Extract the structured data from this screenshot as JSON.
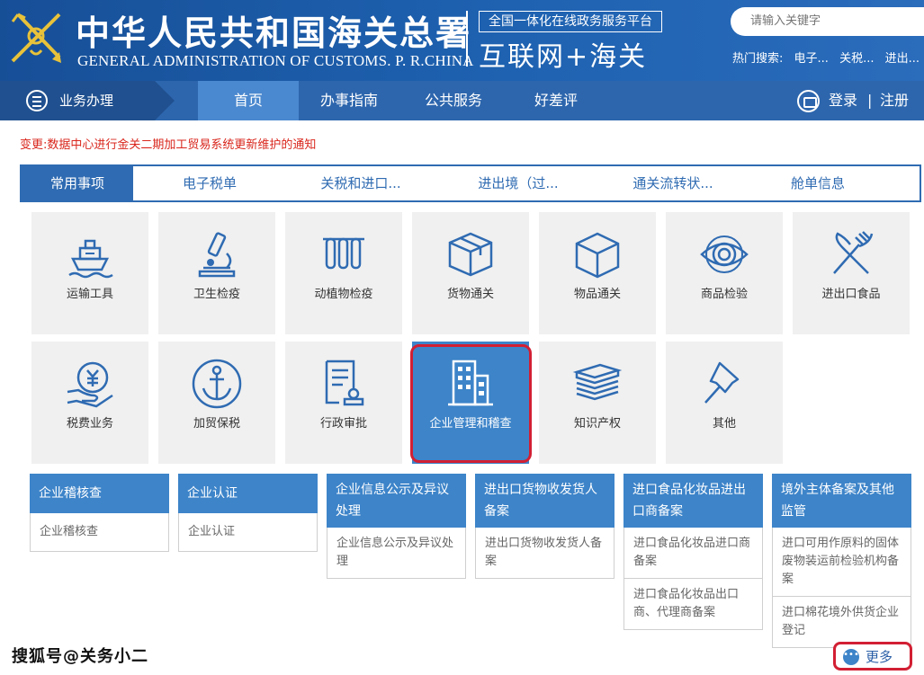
{
  "header": {
    "org_cn": "中华人民共和国海关总署",
    "org_en": "GENERAL ADMINISTRATION OF CUSTOMS. P. R.CHINA",
    "platform": "全国一体化在线政务服务平台",
    "platform_sub": "互联网+海关",
    "search_placeholder": "请输入关键字",
    "hot_label": "热门搜索:",
    "hot_items": [
      "电子...",
      "关税...",
      "进出..."
    ]
  },
  "nav": {
    "business": "业务办理",
    "items": [
      "首页",
      "办事指南",
      "公共服务",
      "好差评"
    ],
    "login": "登录",
    "separator": "|",
    "register": "注册"
  },
  "notice": "变更:数据中心进行金关二期加工贸易系统更新维护的通知",
  "tabs": [
    "常用事项",
    "电子税单",
    "关税和进口...",
    "进出境（过...",
    "通关流转状...",
    "舱单信息"
  ],
  "tiles": [
    {
      "label": "运输工具",
      "icon": "ship-icon"
    },
    {
      "label": "卫生检疫",
      "icon": "microscope-icon"
    },
    {
      "label": "动植物检疫",
      "icon": "test-tubes-icon"
    },
    {
      "label": "货物通关",
      "icon": "package-icon"
    },
    {
      "label": "物品通关",
      "icon": "cube-icon"
    },
    {
      "label": "商品检验",
      "icon": "eye-icon"
    },
    {
      "label": "进出口食品",
      "icon": "fork-knife-icon"
    },
    {
      "label": "税费业务",
      "icon": "yuan-hand-icon"
    },
    {
      "label": "加贸保税",
      "icon": "anchor-icon"
    },
    {
      "label": "行政审批",
      "icon": "document-stamp-icon"
    },
    {
      "label": "企业管理和稽查",
      "icon": "building-icon"
    },
    {
      "label": "知识产权",
      "icon": "books-icon"
    },
    {
      "label": "其他",
      "icon": "pin-icon"
    }
  ],
  "panels": [
    {
      "title": "企业稽核查",
      "items": [
        "企业稽核查"
      ]
    },
    {
      "title": "企业认证",
      "items": [
        "企业认证"
      ]
    },
    {
      "title": "企业信息公示及异议处理",
      "items": [
        "企业信息公示及异议处理"
      ]
    },
    {
      "title": "进出口货物收发货人备案",
      "items": [
        "进出口货物收发货人备案"
      ]
    },
    {
      "title": "进口食品化妆品进出口商备案",
      "items": [
        "进口食品化妆品进口商备案",
        "进口食品化妆品出口商、代理商备案"
      ]
    },
    {
      "title": "境外主体备案及其他监管",
      "items": [
        "进口可用作原料的固体废物装运前检验机构备案",
        "进口棉花境外供货企业登记"
      ]
    }
  ],
  "more": "更多",
  "watermark": "搜狐号@关务小二",
  "colors": {
    "header": "#1e62b1",
    "nav": "#2d66ad",
    "accent": "#3d84c9",
    "highlight": "#d21f33",
    "notice": "#d9261c"
  }
}
